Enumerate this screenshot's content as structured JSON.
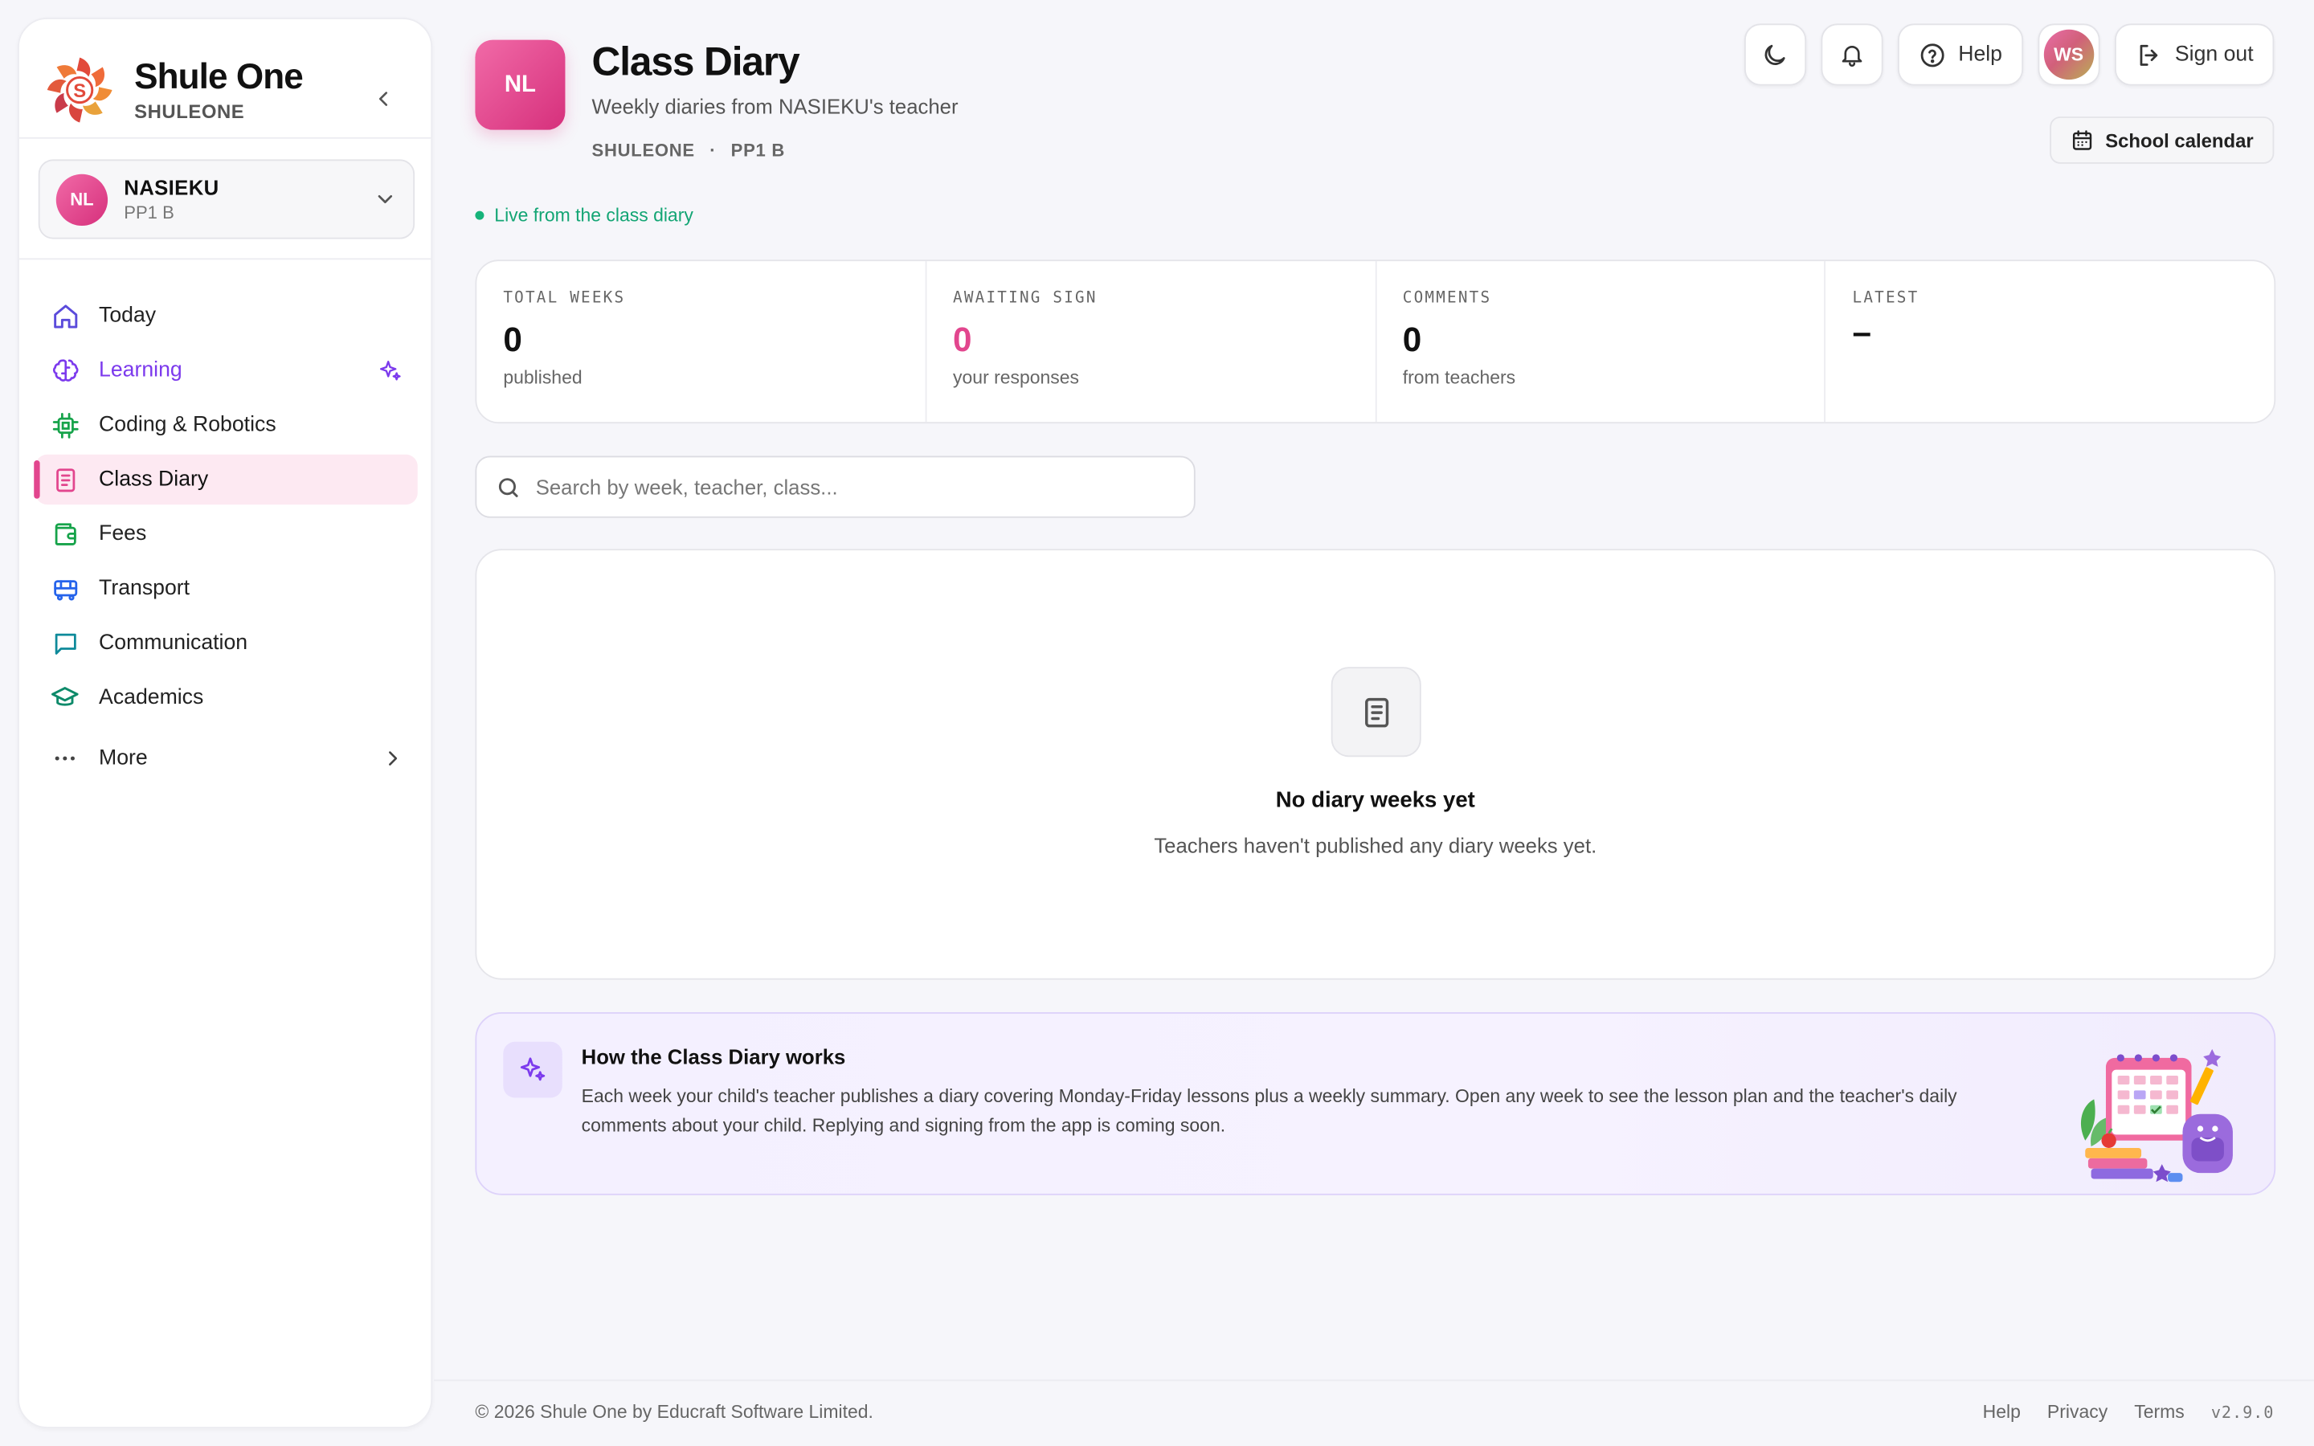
{
  "app": {
    "name": "Shule One",
    "school": "SHULEONE"
  },
  "student": {
    "initials": "NL",
    "name": "NASIEKU",
    "class": "PP1 B"
  },
  "nav": {
    "items": [
      {
        "label": "Today",
        "icon": "home-icon",
        "color": "#5b4bdb"
      },
      {
        "label": "Learning",
        "icon": "brain-icon",
        "color": "#7c3aed"
      },
      {
        "label": "Coding & Robotics",
        "icon": "chip-icon",
        "color": "#16a34a"
      },
      {
        "label": "Class Diary",
        "icon": "book-icon",
        "color": "#e2468e"
      },
      {
        "label": "Fees",
        "icon": "wallet-icon",
        "color": "#16a34a"
      },
      {
        "label": "Transport",
        "icon": "bus-icon",
        "color": "#2563eb"
      },
      {
        "label": "Communication",
        "icon": "chat-icon",
        "color": "#0e8a9a"
      },
      {
        "label": "Academics",
        "icon": "graduation-cap-icon",
        "color": "#0e8a6a"
      }
    ],
    "more_label": "More"
  },
  "header": {
    "badge": "NL",
    "title": "Class Diary",
    "subtitle": "Weekly diaries from NASIEKU's teacher",
    "crumb_school": "SHULEONE",
    "crumb_sep": "·",
    "crumb_class": "PP1 B",
    "live_text": "Live from the class diary"
  },
  "top_actions": {
    "help_label": "Help",
    "user_initials": "WS",
    "signout_label": "Sign out",
    "calendar_label": "School calendar"
  },
  "stats": [
    {
      "label": "TOTAL WEEKS",
      "value": "0",
      "note": "published"
    },
    {
      "label": "AWAITING SIGN",
      "value": "0",
      "note": "your responses"
    },
    {
      "label": "COMMENTS",
      "value": "0",
      "note": "from teachers"
    },
    {
      "label": "LATEST",
      "value": "–",
      "note": ""
    }
  ],
  "search": {
    "placeholder": "Search by week, teacher, class..."
  },
  "empty_state": {
    "title": "No diary weeks yet",
    "text": "Teachers haven't published any diary weeks yet."
  },
  "info": {
    "title": "How the Class Diary works",
    "text": "Each week your child's teacher publishes a diary covering Monday-Friday lessons plus a weekly summary. Open any week to see the lesson plan and the teacher's daily comments about your child. Replying and signing from the app is coming soon."
  },
  "footer": {
    "copyright": "© 2026 Shule One by Educraft Software Limited.",
    "help": "Help",
    "privacy": "Privacy",
    "terms": "Terms",
    "version": "v2.9.0"
  },
  "colors": {
    "accent_pink": "#e2468e",
    "accent_purple": "#7c3aed",
    "live_green": "#13a574"
  }
}
